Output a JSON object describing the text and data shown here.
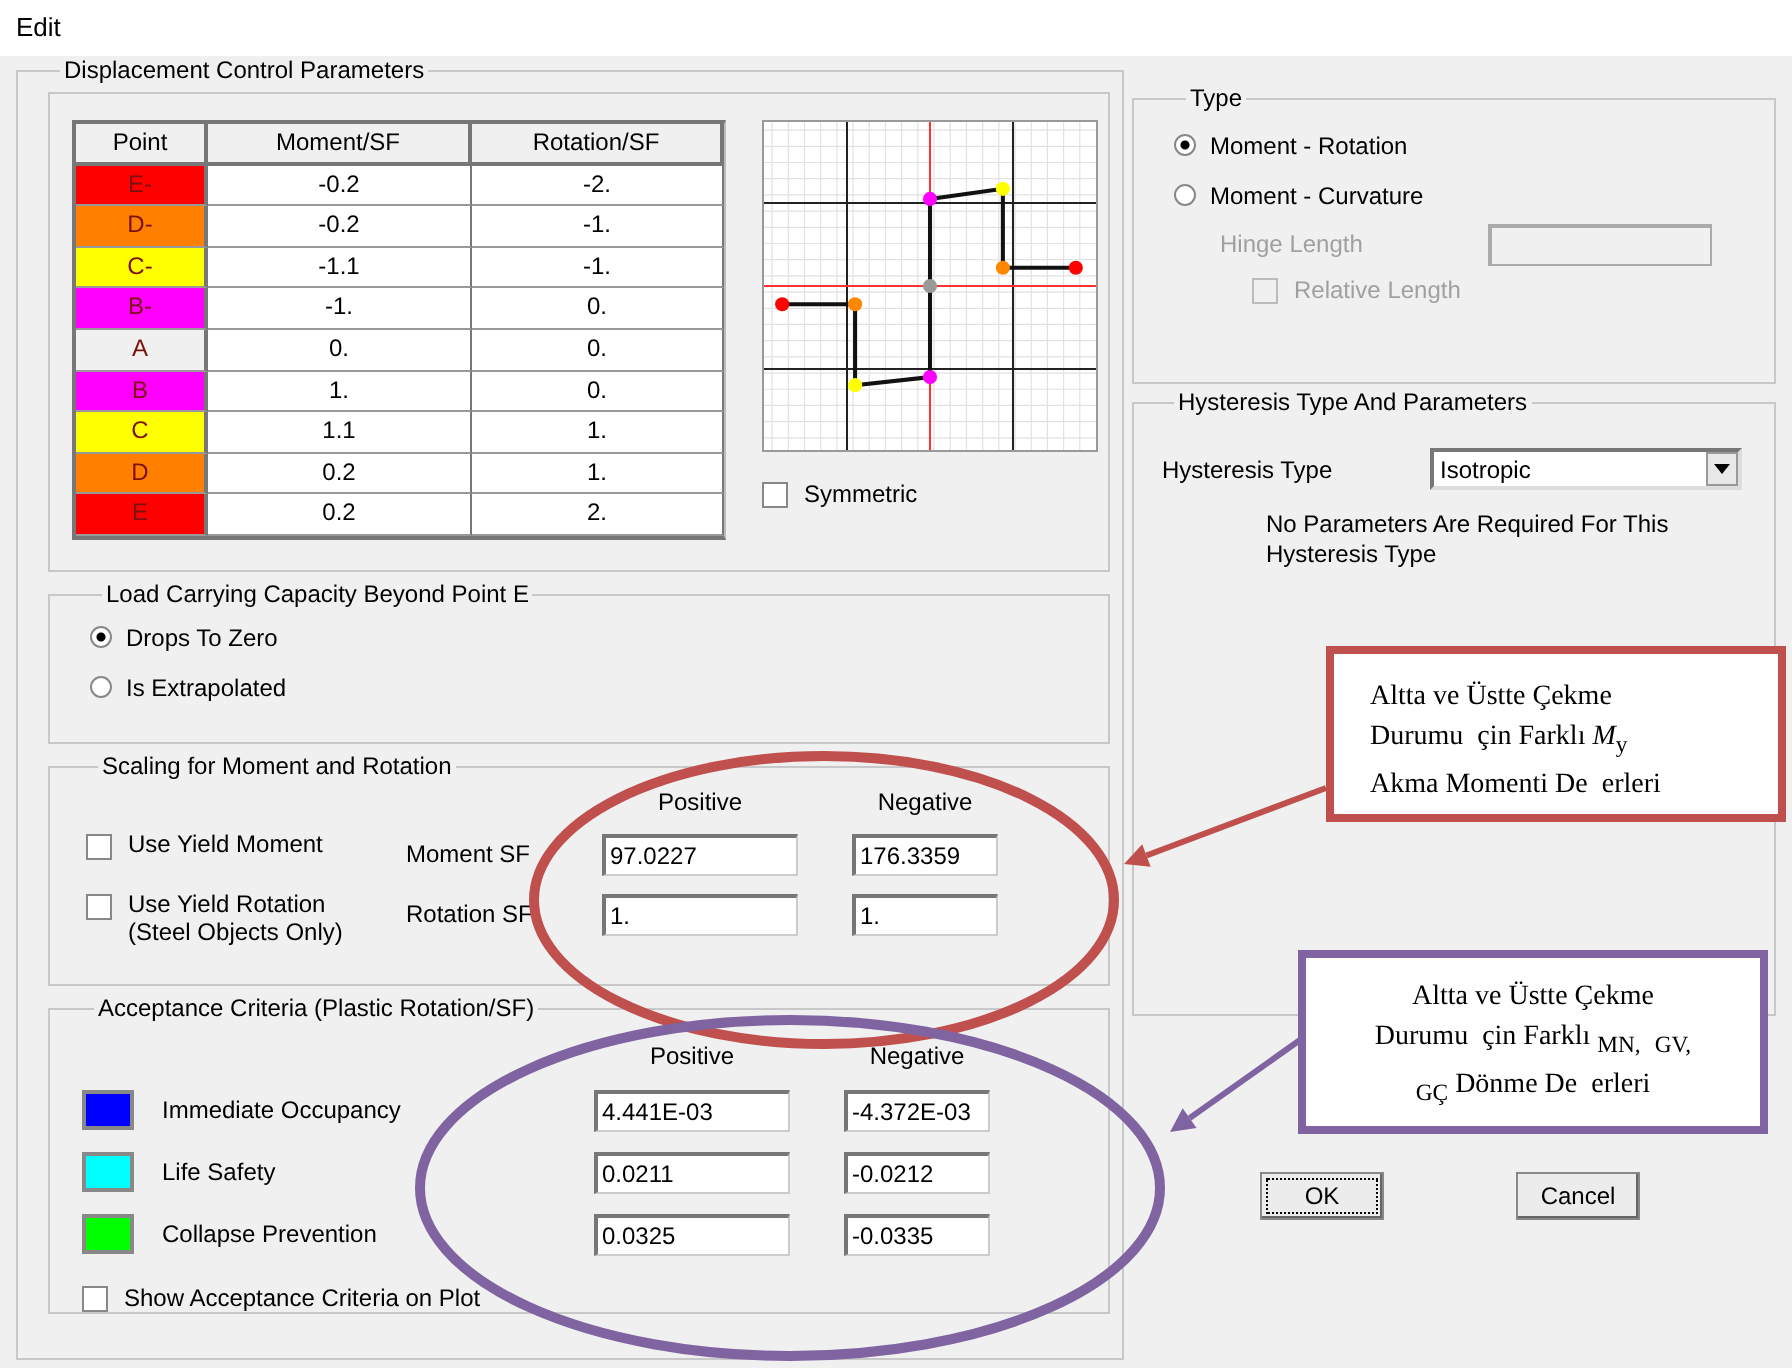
{
  "dialog": {
    "title": "Edit"
  },
  "displacement": {
    "title": "Displacement Control Parameters",
    "columns": [
      "Point",
      "Moment/SF",
      "Rotation/SF"
    ],
    "rows": [
      {
        "point": "E-",
        "color": "#ff0000",
        "moment": "-0.2",
        "rotation": "-2."
      },
      {
        "point": "D-",
        "color": "#ff8000",
        "moment": "-0.2",
        "rotation": "-1."
      },
      {
        "point": "C-",
        "color": "#ffff00",
        "moment": "-1.1",
        "rotation": "-1."
      },
      {
        "point": "B-",
        "color": "#ff00ff",
        "moment": "-1.",
        "rotation": "0."
      },
      {
        "point": "A",
        "color": "#f0f0f0",
        "moment": "0.",
        "rotation": "0."
      },
      {
        "point": "B",
        "color": "#ff00ff",
        "moment": "1.",
        "rotation": "0."
      },
      {
        "point": "C",
        "color": "#ffff00",
        "moment": "1.1",
        "rotation": "1."
      },
      {
        "point": "D",
        "color": "#ff8000",
        "moment": "0.2",
        "rotation": "1."
      },
      {
        "point": "E",
        "color": "#ff0000",
        "moment": "0.2",
        "rotation": "2."
      }
    ],
    "symmetric": {
      "label": "Symmetric",
      "checked": false
    }
  },
  "load_capacity": {
    "title": "Load Carrying Capacity Beyond Point E",
    "options": [
      {
        "label": "Drops To Zero",
        "selected": true
      },
      {
        "label": "Is Extrapolated",
        "selected": false
      }
    ]
  },
  "scaling": {
    "title": "Scaling for Moment and Rotation",
    "headers": [
      "Positive",
      "Negative"
    ],
    "rows": [
      {
        "checkbox_label": "Use Yield Moment",
        "note": "",
        "checked": false,
        "field_label": "Moment SF",
        "positive": "97.0227",
        "negative": "176.3359"
      },
      {
        "checkbox_label": "Use Yield Rotation",
        "note": "(Steel Objects Only)",
        "checked": false,
        "field_label": "Rotation SF",
        "positive": "1.",
        "negative": "1."
      }
    ]
  },
  "acceptance": {
    "title": "Acceptance Criteria (Plastic Rotation/SF)",
    "headers": [
      "Positive",
      "Negative"
    ],
    "rows": [
      {
        "label": "Immediate Occupancy",
        "color": "#0000ff",
        "positive": "4.441E-03",
        "negative": "-4.372E-03"
      },
      {
        "label": "Life Safety",
        "color": "#00ffff",
        "positive": "0.0211",
        "negative": "-0.0212"
      },
      {
        "label": "Collapse Prevention",
        "color": "#00ff00",
        "positive": "0.0325",
        "negative": "-0.0335"
      }
    ],
    "show_on_plot": {
      "label": "Show Acceptance Criteria on Plot",
      "checked": false
    }
  },
  "type": {
    "title": "Type",
    "options": [
      {
        "label": "Moment - Rotation",
        "selected": true
      },
      {
        "label": "Moment - Curvature",
        "selected": false
      }
    ],
    "hinge_length": {
      "label": "Hinge Length",
      "disabled": true
    },
    "relative_length": {
      "label": "Relative Length",
      "checked": false,
      "disabled": true
    }
  },
  "hysteresis": {
    "title": "Hysteresis Type And Parameters",
    "label": "Hysteresis Type",
    "value": "Isotropic",
    "note": "No Parameters Are Required For This Hysteresis Type"
  },
  "buttons": [
    {
      "label": "OK",
      "focused": true
    },
    {
      "label": "Cancel",
      "focused": false
    }
  ],
  "annotations": [
    {
      "color": "#c0504d",
      "lines": [
        "Altta ve Üstte Çekme",
        "Durumu  çin Farklı *M*$_{y}$",
        "Akma Momenti De  erleri"
      ]
    },
    {
      "color": "#8064a2",
      "lines": [
        "Altta ve Üstte Çekme",
        "Durumu  çin Farklı $_{MN,}$  $_{GV,}$",
        "$_{GÇ}$ Dönme De  erleri"
      ]
    }
  ]
}
